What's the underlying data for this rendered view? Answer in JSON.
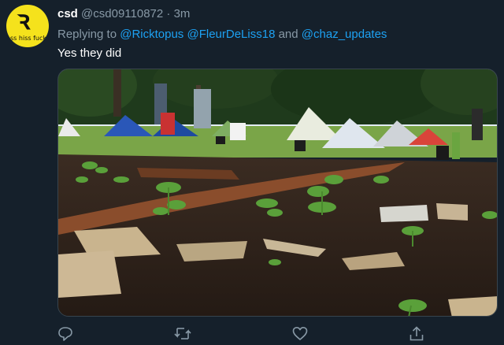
{
  "tweet": {
    "avatar_icon": "snake-logo",
    "avatar_text": "ss hiss fuck",
    "display_name": "csd",
    "handle": "@csd09110872",
    "separator": "·",
    "time": "3m",
    "reply_prefix": "Replying to",
    "mentions": [
      "@Ricktopus",
      "@FleurDeLiss18",
      "@chaz_updates"
    ],
    "reply_conjunction": "and",
    "text": "Yes they did"
  },
  "actions": [
    {
      "icon": "reply-icon"
    },
    {
      "icon": "retweet-icon"
    },
    {
      "icon": "like-icon"
    },
    {
      "icon": "share-icon"
    }
  ],
  "colors": {
    "background": "#15202b",
    "accent": "#1da1f2",
    "secondary_text": "#8899a6"
  }
}
